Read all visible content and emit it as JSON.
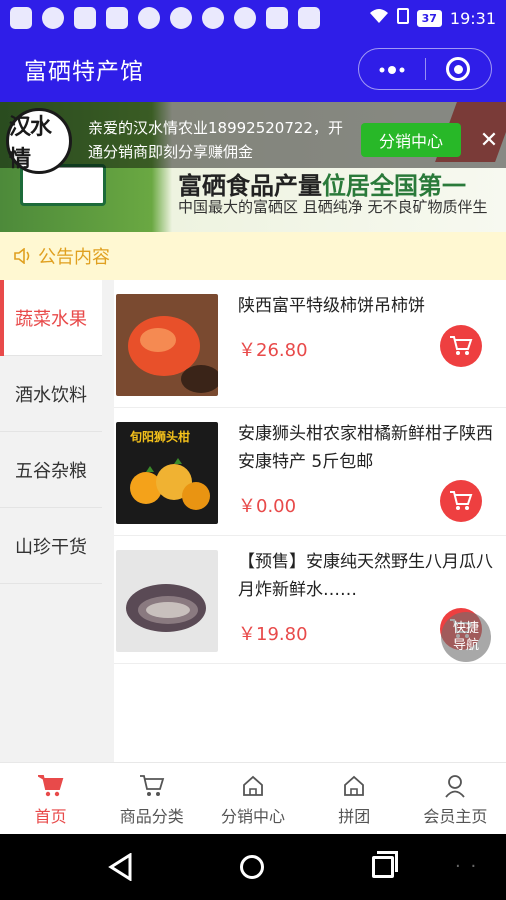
{
  "status_bar": {
    "battery": "37",
    "time": "19:31"
  },
  "header": {
    "title": "富硒特产馆",
    "more_icon": "more-dots-icon",
    "close_mini_icon": "target-icon"
  },
  "banner": {
    "headline_part1": "富硒食品产量",
    "headline_part2": "位居全国第一",
    "subline": "中国最大的富硒区 且硒纯净 无不良矿物质伴生"
  },
  "promo": {
    "avatar_text": "汉水情",
    "message": "亲爱的汉水情农业18992520722，开通分销商即刻分享赚佣金",
    "button_label": "分销中心",
    "close_label": "✕"
  },
  "notice": {
    "label": "公告内容"
  },
  "categories": [
    {
      "label": "蔬菜水果",
      "active": true
    },
    {
      "label": "酒水饮料",
      "active": false
    },
    {
      "label": "五谷杂粮",
      "active": false
    },
    {
      "label": "山珍干货",
      "active": false
    }
  ],
  "products": [
    {
      "name": "陕西富平特级柿饼吊柿饼",
      "price": "￥26.80",
      "thumb_label": ""
    },
    {
      "name": "安康狮头柑农家柑橘新鲜柑子陕西安康特产 5斤包邮",
      "price": "￥0.00",
      "thumb_label": "旬阳狮头柑"
    },
    {
      "name": "【预售】安康纯天然野生八月瓜八月炸新鲜水……",
      "price": "￥19.80",
      "thumb_label": ""
    }
  ],
  "quick_nav": {
    "line1": "快捷",
    "line2": "导航"
  },
  "tabs": [
    {
      "label": "首页",
      "icon": "cart-filled-icon",
      "active": true
    },
    {
      "label": "商品分类",
      "icon": "cart-outline-icon",
      "active": false
    },
    {
      "label": "分销中心",
      "icon": "home-icon",
      "active": false
    },
    {
      "label": "拼团",
      "icon": "home-icon",
      "active": false
    },
    {
      "label": "会员主页",
      "icon": "user-icon",
      "active": false
    }
  ],
  "colors": {
    "brand": "#2f1ee8",
    "accent": "#e84a4a",
    "promo_button": "#28b828",
    "notice_bg": "#fff8d2"
  }
}
